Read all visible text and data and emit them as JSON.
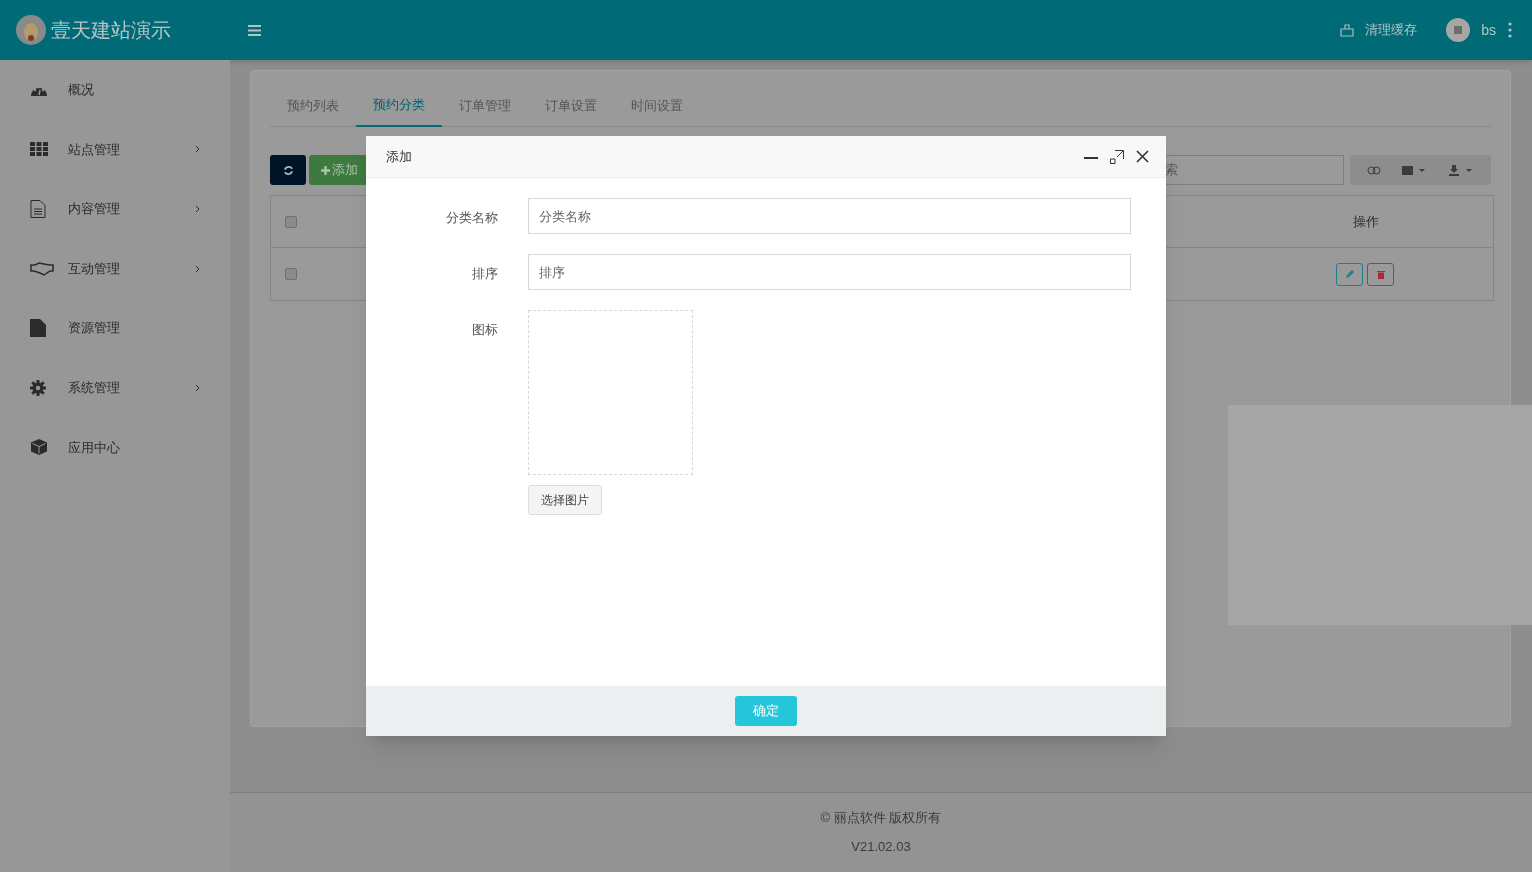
{
  "brand": {
    "title": "壹天建站演示"
  },
  "topbar": {
    "clear_cache": "清理缓存",
    "user": "bs"
  },
  "sidebar": {
    "items": [
      {
        "kind": "gauge",
        "label": "概况",
        "expandable": false
      },
      {
        "kind": "grid",
        "label": "站点管理",
        "expandable": true
      },
      {
        "kind": "doc",
        "label": "内容管理",
        "expandable": true
      },
      {
        "kind": "hands",
        "label": "互动管理",
        "expandable": true
      },
      {
        "kind": "file",
        "label": "资源管理",
        "expandable": false
      },
      {
        "kind": "gear",
        "label": "系统管理",
        "expandable": true
      },
      {
        "kind": "cube",
        "label": "应用中心",
        "expandable": false
      }
    ]
  },
  "tabs": [
    {
      "label": "预约列表",
      "selected": false
    },
    {
      "label": "预约分类",
      "selected": true
    },
    {
      "label": "订单管理",
      "selected": false
    },
    {
      "label": "订单设置",
      "selected": false
    },
    {
      "label": "时间设置",
      "selected": false
    }
  ],
  "toolbar": {
    "add": "添加",
    "search_placeholder": "索"
  },
  "table": {
    "header_checked": false,
    "action_column": "操作",
    "rows": [
      {
        "checked": false
      }
    ]
  },
  "dialog": {
    "title": "添加",
    "fields": [
      {
        "kind": "text",
        "label": "分类名称",
        "placeholder": "分类名称"
      },
      {
        "kind": "text",
        "label": "排序",
        "placeholder": "排序"
      },
      {
        "kind": "image",
        "label": "图标",
        "button": "选择图片"
      }
    ],
    "confirm": "确定"
  },
  "footer": {
    "copyright": "© 丽点软件 版权所有",
    "version": "V21.02.03"
  }
}
